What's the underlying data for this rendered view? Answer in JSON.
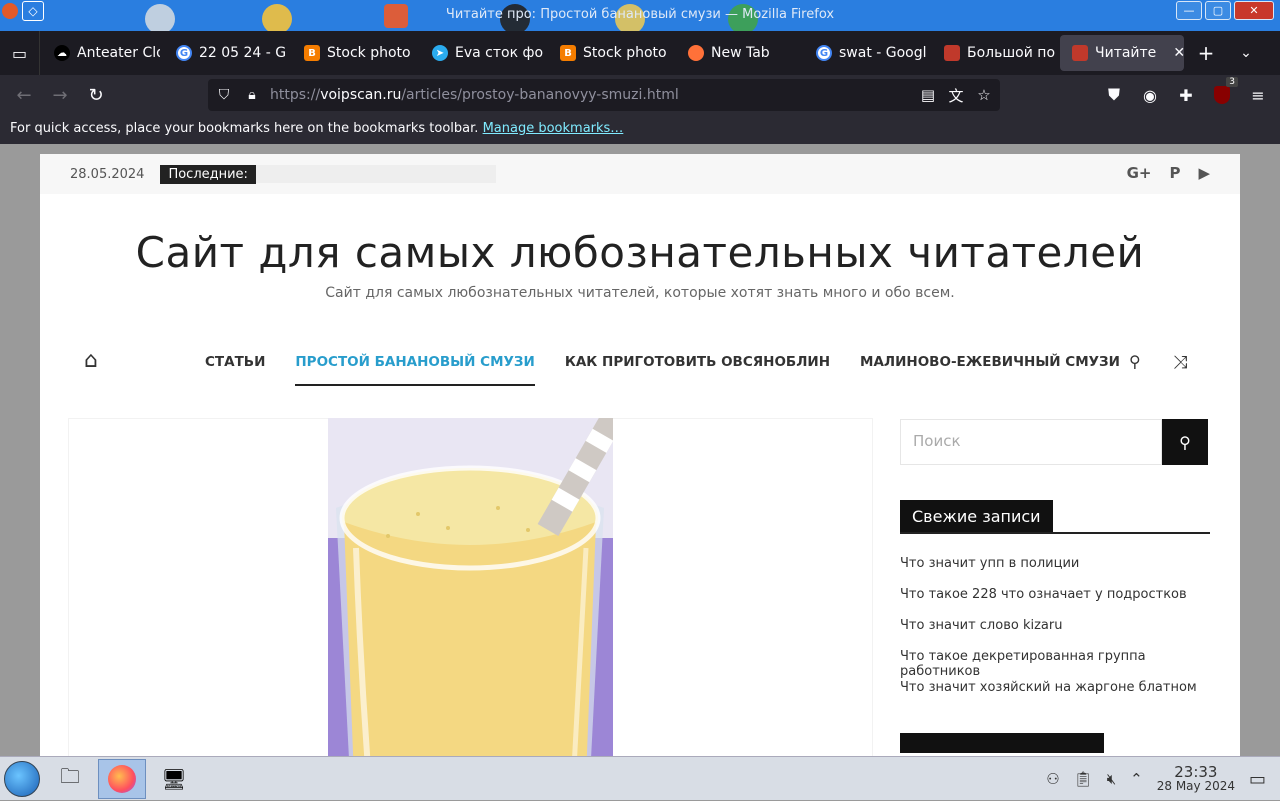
{
  "window": {
    "title": "Читайте про: Простой банановый смузи — Mozilla Firefox",
    "buttons": {
      "minimize": "—",
      "maximize": "▢",
      "close": "✕"
    },
    "app_icon": "firefox-icon",
    "menu_icon": "◇"
  },
  "tabs": [
    {
      "label": "Anteater Clo",
      "icon": "cloud-icon",
      "color": "#000000",
      "active": false
    },
    {
      "label": "22 05 24 - G",
      "icon": "google-icon",
      "color": "#4285f4",
      "active": false
    },
    {
      "label": "Stock photo",
      "icon": "blogger-icon",
      "color": "#f57d00",
      "active": false
    },
    {
      "label": "Eva сток фо",
      "icon": "telegram-icon",
      "color": "#2aabee",
      "active": false
    },
    {
      "label": "Stock photo",
      "icon": "blogger-icon",
      "color": "#f57d00",
      "active": false
    },
    {
      "label": "New Tab",
      "icon": "firefox-icon",
      "color": "#ff7139",
      "active": false
    },
    {
      "label": "swat - Googl",
      "icon": "google-icon",
      "color": "#4285f4",
      "active": false
    },
    {
      "label": "Большой по",
      "icon": "site-icon",
      "color": "#c0392b",
      "active": false
    },
    {
      "label": "Читайте",
      "icon": "site-icon",
      "color": "#c0392b",
      "active": true
    }
  ],
  "tab_close": "✕",
  "new_tab": "+",
  "tabs_menu": "⌄",
  "navbar": {
    "back": "←",
    "forward": "→",
    "reload": "↻",
    "url_prefix": "https://",
    "url_domain": "voipscan.ru",
    "url_path": "/articles/prostoy-bananovyy-smuzi.html",
    "ublock_badge": "3"
  },
  "bookmarks_bar": {
    "text": "For quick access, place your bookmarks here on the bookmarks toolbar.",
    "link": "Manage bookmarks…"
  },
  "site": {
    "date": "28.05.2024",
    "latest_label": "Последние:",
    "social": [
      "G+",
      "P",
      "▶"
    ],
    "title": "Сайт для самых любознательных читателей",
    "description": "Сайт для самых любознательных читателей, которые хотят знать много и обо всем.",
    "menu": [
      {
        "label": "СТАТЬИ",
        "active": false
      },
      {
        "label": "ПРОСТОЙ БАНАНОВЫЙ СМУЗИ",
        "active": true
      },
      {
        "label": "КАК ПРИГОТОВИТЬ ОВСЯНОБЛИН",
        "active": false
      },
      {
        "label": "МАЛИНОВО-ЕЖЕВИЧНЫЙ СМУЗИ",
        "active": false
      }
    ],
    "accent_color": "#289dcc",
    "search_placeholder": "Поиск",
    "recent_title": "Свежие записи",
    "recent_posts": [
      "Что значит упп в полиции",
      "Что такое 228 что означает у подростков",
      "Что значит слово kizaru",
      "Что такое декретированная группа работников",
      "Что значит хозяйский на жаргоне блатном"
    ]
  },
  "taskbar": {
    "time": "23:33",
    "date": "28 May 2024"
  }
}
